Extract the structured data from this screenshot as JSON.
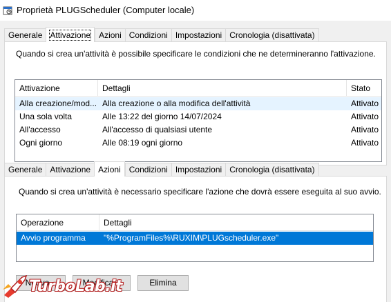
{
  "window": {
    "title": "Proprietà PLUGScheduler (Computer locale)"
  },
  "tabs_top": [
    "Generale",
    "Attivazione",
    "Azioni",
    "Condizioni",
    "Impostazioni",
    "Cronologia (disattivata)"
  ],
  "triggers": {
    "description": "Quando si crea un'attività è possibile specificare le condizioni che ne determineranno l'attivazione.",
    "columns": [
      "Attivazione",
      "Dettagli",
      "Stato"
    ],
    "rows": [
      [
        "Alla creazione/mod...",
        "Alla creazione o alla modifica dell'attività",
        "Attivato"
      ],
      [
        "Una sola volta",
        "Alle 13:22 del giorno 14/07/2024",
        "Attivato"
      ],
      [
        "All'accesso",
        "All'accesso di qualsiasi utente",
        "Attivato"
      ],
      [
        "Ogni giorno",
        "Alle 08:19 ogni giorno",
        "Attivato"
      ]
    ]
  },
  "tabs_actions": [
    "Generale",
    "Attivazione",
    "Azioni",
    "Condizioni",
    "Impostazioni",
    "Cronologia (disattivata)"
  ],
  "actions": {
    "description": "Quando si crea un'attività è necessario specificare l'azione che dovrà essere eseguita al suo avvio.",
    "columns": [
      "Operazione",
      "Dettagli"
    ],
    "rows": [
      [
        "Avvio programma",
        "\"%ProgramFiles%\\RUXIM\\PLUGscheduler.exe\""
      ]
    ]
  },
  "buttons": {
    "new": "Nuovo...",
    "edit": "Modifica...",
    "delete": "Elimina"
  },
  "watermark": {
    "brand": "TurboLab.it"
  }
}
